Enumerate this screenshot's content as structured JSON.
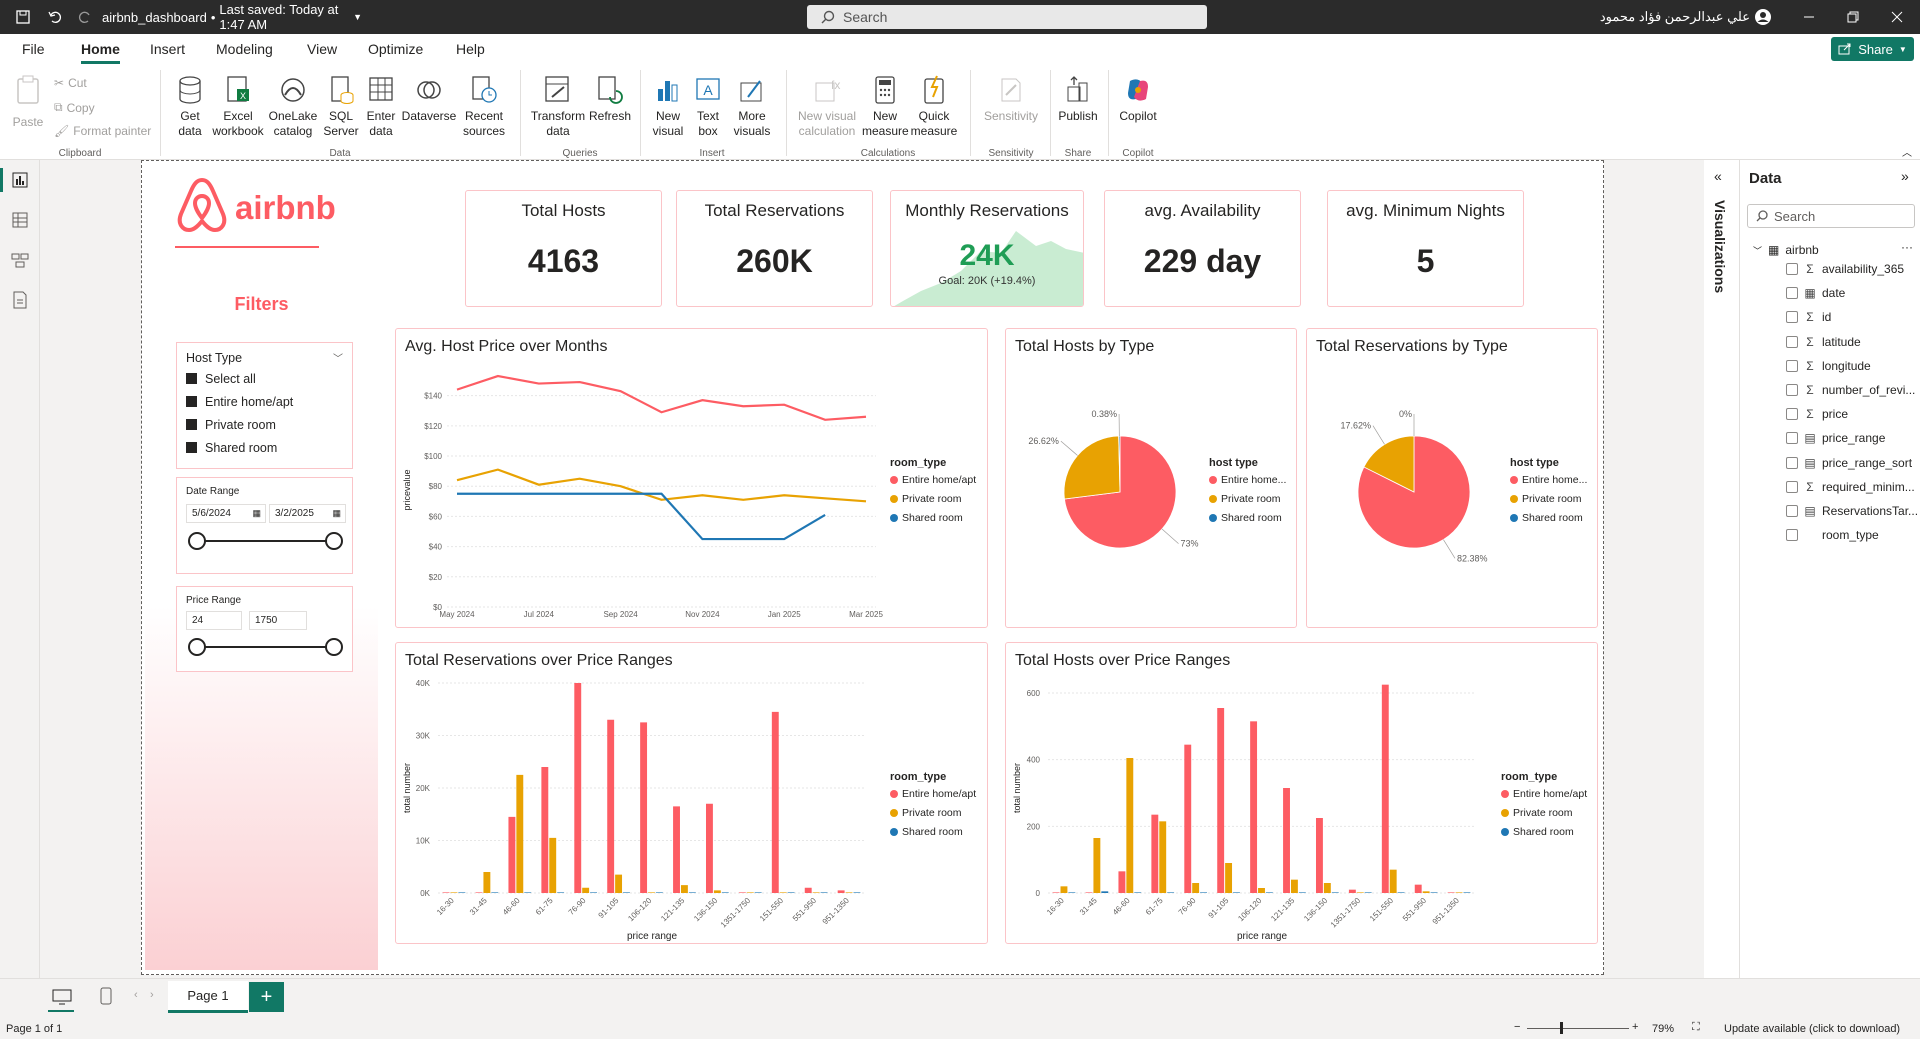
{
  "titlebar": {
    "file_name": "airbnb_dashboard",
    "saved_status": "Last saved: Today at 1:47 AM",
    "search_placeholder": "Search",
    "user_name": "علي عبدالرحمن فؤاد محمود"
  },
  "menu": {
    "items": [
      "File",
      "Home",
      "Insert",
      "Modeling",
      "View",
      "Optimize",
      "Help"
    ],
    "share_label": "Share"
  },
  "ribbon": {
    "clipboard": {
      "paste": "Paste",
      "cut": "Cut",
      "copy": "Copy",
      "format_painter": "Format painter",
      "label": "Clipboard"
    },
    "data": {
      "get_data": "Get data",
      "excel": "Excel workbook",
      "onelake": "OneLake catalog",
      "sql": "SQL Server",
      "enter": "Enter data",
      "dataverse": "Dataverse",
      "recent": "Recent sources",
      "label": "Data"
    },
    "queries": {
      "transform": "Transform data",
      "refresh": "Refresh",
      "label": "Queries"
    },
    "insert": {
      "new_visual": "New visual",
      "text_box": "Text box",
      "more_visuals": "More visuals",
      "label": "Insert"
    },
    "calculations": {
      "new_visual_calc": "New visual calculation",
      "new_measure": "New measure",
      "quick_measure": "Quick measure",
      "label": "Calculations"
    },
    "sensitivity": {
      "sensitivity": "Sensitivity",
      "label": "Sensitivity"
    },
    "share": {
      "publish": "Publish",
      "label": "Share"
    },
    "copilot": {
      "copilot": "Copilot",
      "label": "Copilot"
    }
  },
  "filters": {
    "logo_text": "airbnb",
    "heading": "Filters",
    "host_type": {
      "title": "Host Type",
      "options": [
        "Select all",
        "Entire home/apt",
        "Private room",
        "Shared room"
      ]
    },
    "date_range": {
      "title": "Date Range",
      "start": "5/6/2024",
      "end": "3/2/2025"
    },
    "price_range": {
      "title": "Price Range",
      "min": "24",
      "max": "1750"
    }
  },
  "kpis": {
    "total_hosts": {
      "title": "Total Hosts",
      "value": "4163"
    },
    "total_reservations": {
      "title": "Total Reservations",
      "value": "260K"
    },
    "monthly_reservations": {
      "title": "Monthly Reservations",
      "value": "24K",
      "goal": "Goal: 20K (+19.4%)"
    },
    "avg_availability": {
      "title": "avg. Availability",
      "value": "229 day"
    },
    "avg_min_nights": {
      "title": "avg. Minimum Nights",
      "value": "5"
    }
  },
  "colors": {
    "entire": "#fd5c63",
    "private": "#e8a202",
    "shared": "#1f77b4",
    "accent": "#117865",
    "brand": "#fd5c63"
  },
  "legend": {
    "room_type": "room_type",
    "host_type": "host type",
    "entire": "Entire home/apt",
    "entire_short": "Entire home...",
    "private": "Private room",
    "shared": "Shared room"
  },
  "chart_data": [
    {
      "id": "line",
      "type": "line",
      "title": "Avg. Host Price over Months",
      "xlabel": "",
      "ylabel": "pricevalue",
      "x": [
        "May 2024",
        "Jun 2024",
        "Jul 2024",
        "Aug 2024",
        "Sep 2024",
        "Oct 2024",
        "Nov 2024",
        "Dec 2024",
        "Jan 2025",
        "Feb 2025",
        "Mar 2025"
      ],
      "x_ticks": [
        "May 2024",
        "Jul 2024",
        "Sep 2024",
        "Nov 2024",
        "Jan 2025",
        "Mar 2025"
      ],
      "y_ticks": [
        "$0",
        "$20",
        "$40",
        "$60",
        "$80",
        "$100",
        "$120",
        "$140"
      ],
      "ylim": [
        0,
        155
      ],
      "series": [
        {
          "name": "Entire home/apt",
          "values": [
            144,
            153,
            148,
            149,
            143,
            129,
            137,
            133,
            134,
            124,
            126
          ]
        },
        {
          "name": "Private room",
          "values": [
            84,
            91,
            81,
            85,
            80,
            71,
            74,
            71,
            74,
            72,
            70
          ]
        },
        {
          "name": "Shared room",
          "values": [
            75,
            75,
            75,
            75,
            75,
            75,
            45,
            45,
            45,
            61,
            null
          ]
        }
      ]
    },
    {
      "id": "pie_hosts",
      "type": "pie",
      "title": "Total Hosts by Type",
      "labels": [
        "Entire home/apt",
        "Private room",
        "Shared room"
      ],
      "values": [
        73,
        26.62,
        0.38
      ],
      "value_labels": [
        "73%",
        "26.62%",
        "0.38%"
      ]
    },
    {
      "id": "pie_res",
      "type": "pie",
      "title": "Total Reservations by Type",
      "labels": [
        "Entire home/apt",
        "Private room",
        "Shared room"
      ],
      "values": [
        82.38,
        17.62,
        0
      ],
      "value_labels": [
        "82.38%",
        "17.62%",
        "0%"
      ]
    },
    {
      "id": "bar_res",
      "type": "bar",
      "title": "Total Reservations over Price Ranges",
      "xlabel": "price range",
      "ylabel": "total number",
      "categories": [
        "16-30",
        "31-45",
        "46-60",
        "61-75",
        "76-90",
        "91-105",
        "106-120",
        "121-135",
        "136-150",
        "1351-1750",
        "151-550",
        "551-950",
        "951-1350"
      ],
      "y_ticks": [
        "0K",
        "10K",
        "20K",
        "30K",
        "40K"
      ],
      "ylim": [
        0,
        40000
      ],
      "series": [
        {
          "name": "Entire home/apt",
          "values": [
            0,
            0,
            14500,
            24000,
            40000,
            33000,
            32500,
            16500,
            17000,
            0,
            34500,
            1000,
            500
          ]
        },
        {
          "name": "Private room",
          "values": [
            0,
            4000,
            22500,
            10500,
            1000,
            3500,
            0,
            1500,
            500,
            0,
            0,
            0,
            0
          ]
        },
        {
          "name": "Shared room",
          "values": [
            0,
            0,
            0,
            0,
            0,
            0,
            0,
            0,
            0,
            0,
            0,
            0,
            0
          ]
        }
      ]
    },
    {
      "id": "bar_hosts",
      "type": "bar",
      "title": "Total Hosts over Price Ranges",
      "xlabel": "price range",
      "ylabel": "total number",
      "categories": [
        "16-30",
        "31-45",
        "46-60",
        "61-75",
        "76-90",
        "91-105",
        "106-120",
        "121-135",
        "136-150",
        "1351-1750",
        "151-550",
        "551-950",
        "951-1350"
      ],
      "y_ticks": [
        "0",
        "200",
        "400",
        "600"
      ],
      "ylim": [
        0,
        630
      ],
      "series": [
        {
          "name": "Entire home/apt",
          "values": [
            0,
            0,
            65,
            235,
            445,
            555,
            515,
            315,
            225,
            10,
            625,
            25,
            0
          ]
        },
        {
          "name": "Private room",
          "values": [
            20,
            165,
            405,
            215,
            30,
            90,
            15,
            40,
            30,
            0,
            70,
            5,
            0
          ]
        },
        {
          "name": "Shared room",
          "values": [
            0,
            5,
            0,
            0,
            0,
            0,
            0,
            0,
            0,
            0,
            0,
            0,
            0
          ]
        }
      ]
    }
  ],
  "data_pane": {
    "title": "Data",
    "search_placeholder": "Search",
    "viz_label": "Visualizations",
    "table": "airbnb",
    "fields": [
      {
        "name": "availability_365",
        "icon": "sigma"
      },
      {
        "name": "date",
        "icon": "table"
      },
      {
        "name": "id",
        "icon": "sigma"
      },
      {
        "name": "latitude",
        "icon": "sigma"
      },
      {
        "name": "longitude",
        "icon": "sigma"
      },
      {
        "name": "number_of_revi...",
        "icon": "sigma"
      },
      {
        "name": "price",
        "icon": "sigma"
      },
      {
        "name": "price_range",
        "icon": "calc"
      },
      {
        "name": "price_range_sort",
        "icon": "calc"
      },
      {
        "name": "required_minim...",
        "icon": "sigma"
      },
      {
        "name": "ReservationsTar...",
        "icon": "calc"
      },
      {
        "name": "room_type",
        "icon": "none"
      }
    ]
  },
  "pages": {
    "tab": "Page 1",
    "add": "+"
  },
  "status": {
    "page_info": "Page 1 of 1",
    "zoom": "79%",
    "update": "Update available (click to download)"
  }
}
